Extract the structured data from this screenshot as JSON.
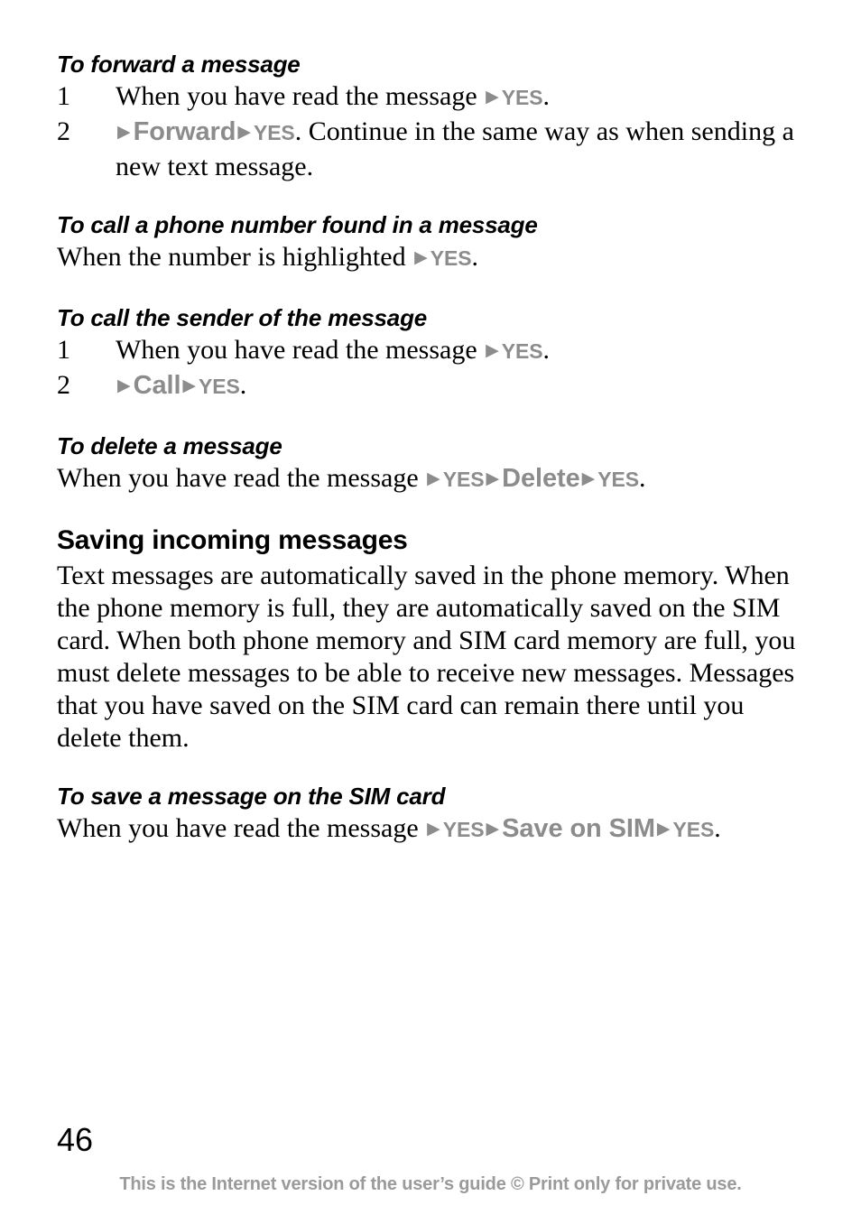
{
  "page": {
    "number": "46",
    "footer_note": "This is the Internet version of the user’s guide © Print only for private use.",
    "arrow_glyph": "▶",
    "colors": {
      "text": "#000000",
      "ui_reference": "#8c8c8c",
      "footer": "#9a9a9a",
      "background": "#ffffff"
    }
  },
  "blocks": [
    {
      "id": "forward-message",
      "heading": "To forward a message",
      "heading_style": "procedure",
      "steps": [
        {
          "num": "1",
          "segments": [
            {
              "type": "text",
              "text": "When you have read the message "
            },
            {
              "type": "arrow"
            },
            {
              "type": "ui",
              "text": "YES",
              "size": "small"
            },
            {
              "type": "text",
              "text": "."
            }
          ]
        },
        {
          "num": "2",
          "segments": [
            {
              "type": "arrow"
            },
            {
              "type": "ui",
              "text": "Forward",
              "size": "large"
            },
            {
              "type": "arrow"
            },
            {
              "type": "ui",
              "text": "YES",
              "size": "small"
            },
            {
              "type": "text",
              "text": ". Continue in the same way as when sending a new text message."
            }
          ]
        }
      ]
    },
    {
      "id": "call-number-in-message",
      "heading": "To call a phone number found in a message",
      "heading_style": "procedure",
      "line": {
        "segments": [
          {
            "type": "text",
            "text": "When the number is highlighted "
          },
          {
            "type": "arrow"
          },
          {
            "type": "ui",
            "text": "YES",
            "size": "small"
          },
          {
            "type": "text",
            "text": "."
          }
        ]
      }
    },
    {
      "id": "call-sender",
      "heading": "To call the sender of the message",
      "heading_style": "procedure",
      "steps": [
        {
          "num": "1",
          "segments": [
            {
              "type": "text",
              "text": "When you have read the message "
            },
            {
              "type": "arrow"
            },
            {
              "type": "ui",
              "text": "YES",
              "size": "small"
            },
            {
              "type": "text",
              "text": "."
            }
          ]
        },
        {
          "num": "2",
          "segments": [
            {
              "type": "arrow"
            },
            {
              "type": "ui",
              "text": "Call",
              "size": "large"
            },
            {
              "type": "arrow"
            },
            {
              "type": "ui",
              "text": "YES",
              "size": "small"
            },
            {
              "type": "text",
              "text": "."
            }
          ]
        }
      ]
    },
    {
      "id": "delete-message",
      "heading": "To delete a message",
      "heading_style": "procedure",
      "line": {
        "segments": [
          {
            "type": "text",
            "text": "When you have read the message "
          },
          {
            "type": "arrow"
          },
          {
            "type": "ui",
            "text": "YES",
            "size": "small"
          },
          {
            "type": "arrow"
          },
          {
            "type": "ui",
            "text": "Delete",
            "size": "large"
          },
          {
            "type": "arrow"
          },
          {
            "type": "ui",
            "text": "YES",
            "size": "small"
          },
          {
            "type": "text",
            "text": "."
          }
        ]
      }
    },
    {
      "id": "saving-incoming-messages",
      "heading": "Saving incoming messages",
      "heading_style": "section",
      "paragraph": "Text messages are automatically saved in the phone memory. When the phone memory is full, they are automatically saved on the SIM card. When both phone memory and SIM card memory are full, you must delete messages to be able to receive new messages. Messages that you have saved on the SIM card can remain there until you delete them."
    },
    {
      "id": "save-message-on-sim",
      "heading": "To save a message on the SIM card",
      "heading_style": "procedure",
      "line": {
        "segments": [
          {
            "type": "text",
            "text": "When you have read the message "
          },
          {
            "type": "arrow"
          },
          {
            "type": "ui",
            "text": "YES",
            "size": "small"
          },
          {
            "type": "arrow"
          },
          {
            "type": "ui",
            "text": "Save on SIM",
            "size": "large"
          },
          {
            "type": "arrow"
          },
          {
            "type": "ui",
            "text": "YES",
            "size": "small"
          },
          {
            "type": "text",
            "text": "."
          }
        ]
      }
    }
  ]
}
